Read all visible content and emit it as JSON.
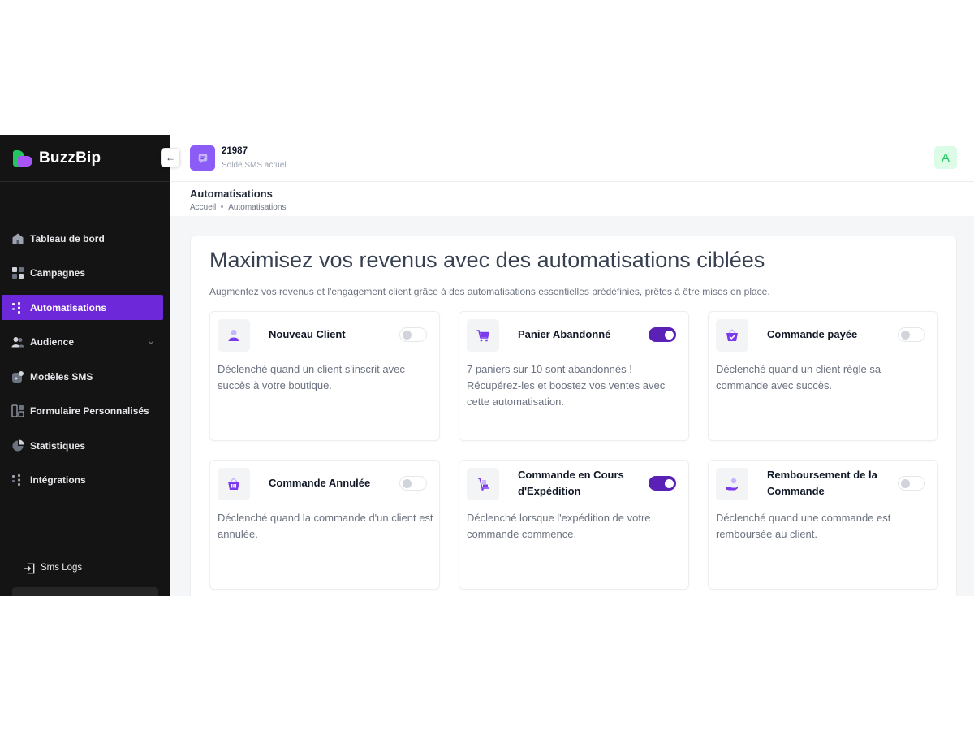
{
  "brand": {
    "name": "BuzzBip"
  },
  "sidebar": {
    "items": [
      {
        "label": "Tableau de bord",
        "icon": "home-icon",
        "active": false
      },
      {
        "label": "Campagnes",
        "icon": "grid-icon",
        "active": false
      },
      {
        "label": "Automatisations",
        "icon": "automation-icon",
        "active": true
      },
      {
        "label": "Audience",
        "icon": "users-icon",
        "active": false,
        "has_submenu": true
      },
      {
        "label": "Modèles SMS",
        "icon": "template-icon",
        "active": false
      },
      {
        "label": "Formulaire Personnalisés",
        "icon": "form-icon",
        "active": false
      },
      {
        "label": "Statistiques",
        "icon": "pie-chart-icon",
        "active": false
      },
      {
        "label": "Intégrations",
        "icon": "integrations-icon",
        "active": false
      }
    ],
    "sms_logs": "Sms Logs"
  },
  "topbar": {
    "sms_balance": "21987",
    "sms_balance_label": "Solde SMS actuel",
    "avatar_initial": "A"
  },
  "page": {
    "title": "Automatisations",
    "breadcrumb": [
      "Accueil",
      "Automatisations"
    ]
  },
  "hero": {
    "title": "Maximisez vos revenus avec des automatisations ciblées",
    "subtitle": "Augmentez vos revenus et l'engagement client grâce à des automatisations essentielles prédéfinies, prêtes à être mises en place."
  },
  "cards": [
    {
      "title": "Nouveau Client",
      "icon": "user-icon",
      "enabled": false,
      "description": "Déclenché quand un client s'inscrit avec succès à votre boutique."
    },
    {
      "title": "Panier Abandonné",
      "icon": "cart-icon",
      "enabled": true,
      "description": "7 paniers sur 10 sont abandonnés ! Récupérez-les et boostez vos ventes avec cette automatisation."
    },
    {
      "title": "Commande payée",
      "icon": "paid-basket-icon",
      "enabled": false,
      "description": "Déclenché quand un client règle sa commande avec succès."
    },
    {
      "title": "Commande Annulée",
      "icon": "basket-icon",
      "enabled": false,
      "description": "Déclenché quand la commande d'un client est annulée."
    },
    {
      "title": "Commande en Cours d'Expédition",
      "icon": "shipping-icon",
      "enabled": true,
      "description": "Déclenché lorsque l'expédition de votre commande commence."
    },
    {
      "title": "Remboursement de la Commande",
      "icon": "refund-icon",
      "enabled": false,
      "description": "Déclenché quand une commande est remboursée au client."
    }
  ],
  "colors": {
    "accent": "#6d28d9",
    "sidebar_bg": "#141414",
    "icon": "#7c3aed"
  }
}
